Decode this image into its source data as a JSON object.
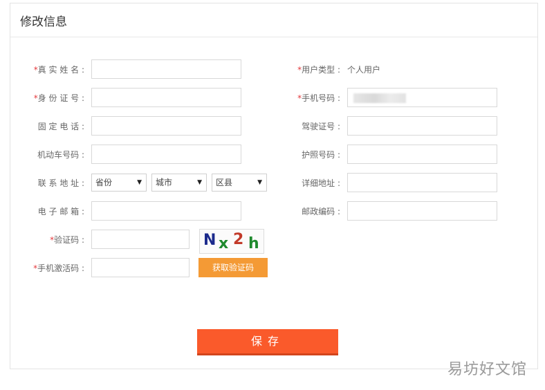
{
  "panel": {
    "title": "修改信息"
  },
  "form": {
    "real_name_label": "真 实 姓 名 :",
    "id_number_label": "身 份 证 号 :",
    "landline_label": "固 定 电 话 :",
    "vehicle_number_label": "机动车号码 :",
    "address_label": "联 系 地 址 :",
    "email_label": "电 子 邮 箱 :",
    "captcha_label": "验证码 :",
    "sms_code_label": "手机激活码 :",
    "user_type_label": "用户类型 :",
    "user_type_value": "个人用户",
    "mobile_label": "手机号码 :",
    "driver_license_label": "驾驶证号 :",
    "passport_label": "护照号码 :",
    "detail_address_label": "详细地址 :",
    "postcode_label": "邮政编码 :",
    "required_mark": "*",
    "province_select": "省份",
    "city_select": "城市",
    "district_select": "区县",
    "select_arrow": "▼",
    "captcha_chars": [
      "N",
      "x",
      "2",
      "h"
    ],
    "captcha_colors": [
      "#1b2a8c",
      "#1f8a2e",
      "#c23a2a",
      "#1f8a2e"
    ],
    "get_code_button": "获取验证码",
    "save_button": "保存"
  },
  "watermark": "易坊好文馆",
  "colors": {
    "required": "#e4393c",
    "sms_button": "#f49a35",
    "save_button": "#fa5a2b"
  }
}
